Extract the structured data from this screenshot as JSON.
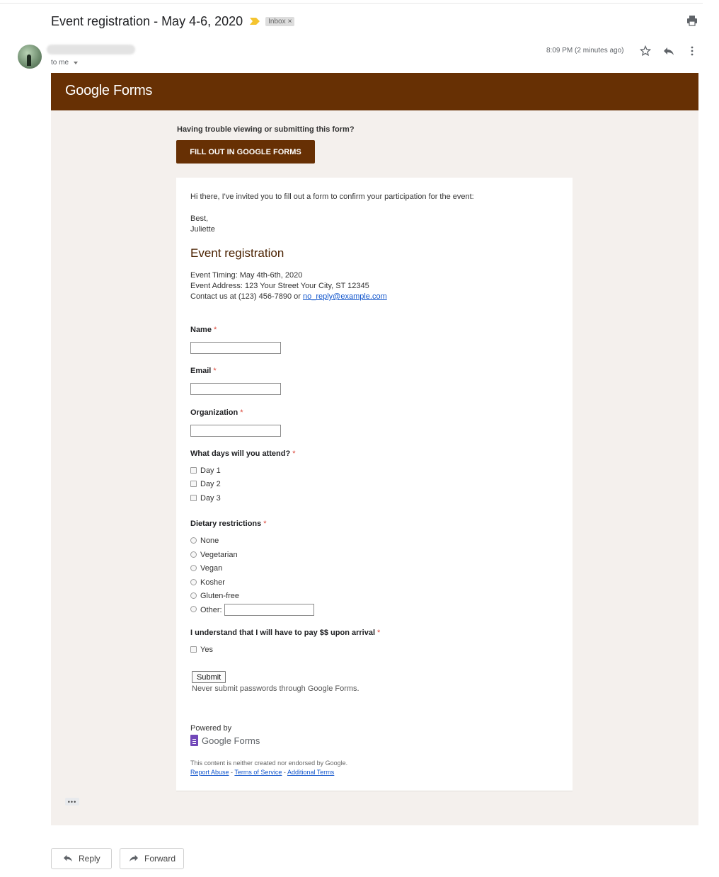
{
  "email": {
    "subject": "Event registration - May 4-6, 2020",
    "label": "Inbox",
    "label_close": "×",
    "recipient": "to me",
    "timestamp": "8:09 PM (2 minutes ago)",
    "icons": [
      "importance-marker-icon",
      "print-icon",
      "star-icon",
      "reply-icon",
      "more-vert-icon"
    ]
  },
  "banner": {
    "logo_word1": "Google",
    "logo_word2": "Forms",
    "color": "#673004"
  },
  "prompt": {
    "trouble_text": "Having trouble viewing or submitting this form?",
    "fill_button": "FILL OUT IN GOOGLE FORMS"
  },
  "form": {
    "intro": "Hi there, I've invited you to fill out a form to confirm your participation for the event:",
    "signoff": "Best,",
    "signature": "Juliette",
    "title": "Event registration",
    "timing": "Event Timing: May 4th-6th, 2020",
    "address": "Event Address: 123 Your Street Your City, ST 12345",
    "contact_prefix": "Contact us at (123) 456-7890 or ",
    "contact_email": "no_reply@example.com",
    "required_mark": "*",
    "fields": {
      "name": "Name",
      "email": "Email",
      "organization": "Organization"
    },
    "days": {
      "label": "What days will you attend?",
      "options": [
        "Day 1",
        "Day 2",
        "Day 3"
      ]
    },
    "diet": {
      "label": "Dietary restrictions",
      "options": [
        "None",
        "Vegetarian",
        "Vegan",
        "Kosher",
        "Gluten-free",
        "Other:"
      ]
    },
    "payment": {
      "label": "I understand that I will have to pay $$ upon arrival",
      "option": "Yes"
    },
    "submit": "Submit",
    "password_note": "Never submit passwords through Google Forms.",
    "powered_by": "Powered by",
    "powered_logo_word1": "Google",
    "powered_logo_word2": "Forms",
    "disclaimer": "This content is neither created nor endorsed by Google.",
    "links": [
      "Report Abuse",
      "Terms of Service",
      "Additional Terms"
    ],
    "link_separator": " - "
  },
  "trimmed_content": "•••",
  "actions": {
    "reply": "Reply",
    "forward": "Forward"
  }
}
